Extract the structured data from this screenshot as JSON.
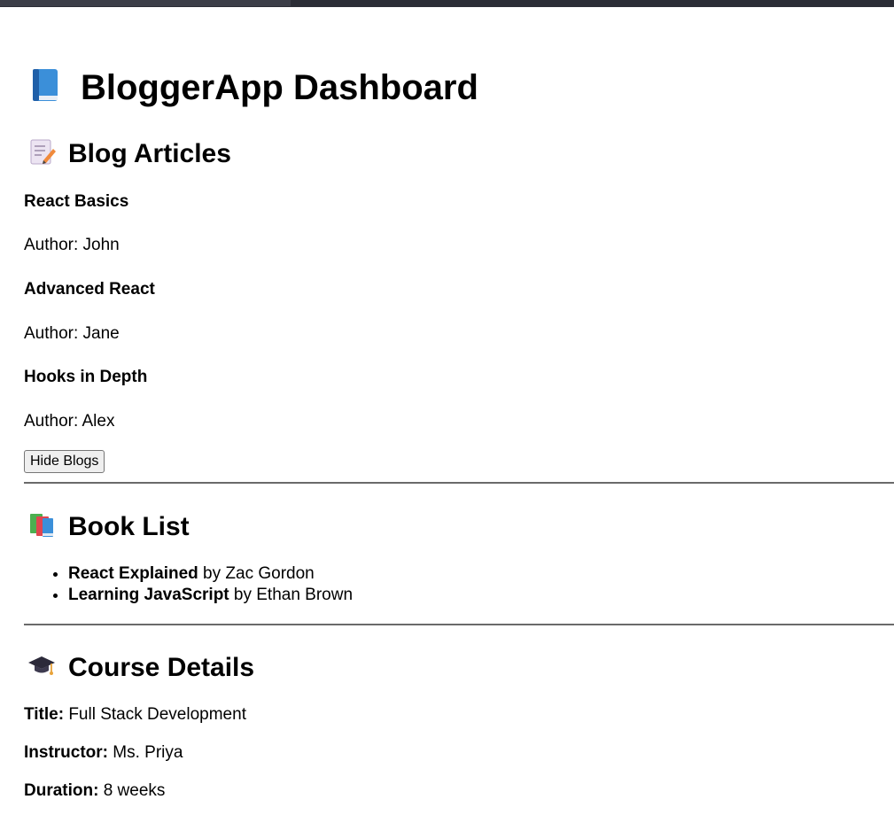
{
  "app": {
    "title": "BloggerApp Dashboard",
    "icon": "blue-book-icon"
  },
  "blogs": {
    "heading": "Blog Articles",
    "icon": "memo-icon",
    "articles": [
      {
        "title": "React Basics",
        "author": "Author: John"
      },
      {
        "title": "Advanced React",
        "author": "Author: Jane"
      },
      {
        "title": "Hooks in Depth",
        "author": "Author: Alex"
      }
    ],
    "toggle_label": "Hide Blogs"
  },
  "books": {
    "heading": "Book List",
    "icon": "books-icon",
    "items": [
      {
        "title": "React Explained",
        "by": " by Zac Gordon"
      },
      {
        "title": "Learning JavaScript",
        "by": " by Ethan Brown"
      }
    ]
  },
  "course": {
    "heading": "Course Details",
    "icon": "graduation-cap-icon",
    "fields": [
      {
        "label": "Title:",
        "value": " Full Stack Development"
      },
      {
        "label": "Instructor:",
        "value": " Ms. Priya"
      },
      {
        "label": "Duration:",
        "value": " 8 weeks"
      }
    ]
  },
  "colors": {
    "topbar": "#2b2d36",
    "divider": "#6a6a6a",
    "button_bg": "#efefef"
  }
}
